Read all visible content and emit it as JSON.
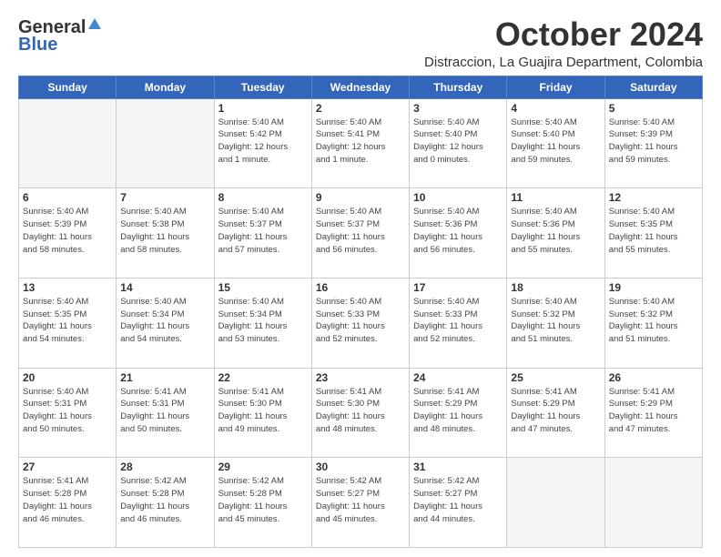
{
  "logo": {
    "general": "General",
    "blue": "Blue"
  },
  "header": {
    "month": "October 2024",
    "location": "Distraccion, La Guajira Department, Colombia"
  },
  "weekdays": [
    "Sunday",
    "Monday",
    "Tuesday",
    "Wednesday",
    "Thursday",
    "Friday",
    "Saturday"
  ],
  "weeks": [
    [
      {
        "day": "",
        "info": ""
      },
      {
        "day": "",
        "info": ""
      },
      {
        "day": "1",
        "info": "Sunrise: 5:40 AM\nSunset: 5:42 PM\nDaylight: 12 hours\nand 1 minute."
      },
      {
        "day": "2",
        "info": "Sunrise: 5:40 AM\nSunset: 5:41 PM\nDaylight: 12 hours\nand 1 minute."
      },
      {
        "day": "3",
        "info": "Sunrise: 5:40 AM\nSunset: 5:40 PM\nDaylight: 12 hours\nand 0 minutes."
      },
      {
        "day": "4",
        "info": "Sunrise: 5:40 AM\nSunset: 5:40 PM\nDaylight: 11 hours\nand 59 minutes."
      },
      {
        "day": "5",
        "info": "Sunrise: 5:40 AM\nSunset: 5:39 PM\nDaylight: 11 hours\nand 59 minutes."
      }
    ],
    [
      {
        "day": "6",
        "info": "Sunrise: 5:40 AM\nSunset: 5:39 PM\nDaylight: 11 hours\nand 58 minutes."
      },
      {
        "day": "7",
        "info": "Sunrise: 5:40 AM\nSunset: 5:38 PM\nDaylight: 11 hours\nand 58 minutes."
      },
      {
        "day": "8",
        "info": "Sunrise: 5:40 AM\nSunset: 5:37 PM\nDaylight: 11 hours\nand 57 minutes."
      },
      {
        "day": "9",
        "info": "Sunrise: 5:40 AM\nSunset: 5:37 PM\nDaylight: 11 hours\nand 56 minutes."
      },
      {
        "day": "10",
        "info": "Sunrise: 5:40 AM\nSunset: 5:36 PM\nDaylight: 11 hours\nand 56 minutes."
      },
      {
        "day": "11",
        "info": "Sunrise: 5:40 AM\nSunset: 5:36 PM\nDaylight: 11 hours\nand 55 minutes."
      },
      {
        "day": "12",
        "info": "Sunrise: 5:40 AM\nSunset: 5:35 PM\nDaylight: 11 hours\nand 55 minutes."
      }
    ],
    [
      {
        "day": "13",
        "info": "Sunrise: 5:40 AM\nSunset: 5:35 PM\nDaylight: 11 hours\nand 54 minutes."
      },
      {
        "day": "14",
        "info": "Sunrise: 5:40 AM\nSunset: 5:34 PM\nDaylight: 11 hours\nand 54 minutes."
      },
      {
        "day": "15",
        "info": "Sunrise: 5:40 AM\nSunset: 5:34 PM\nDaylight: 11 hours\nand 53 minutes."
      },
      {
        "day": "16",
        "info": "Sunrise: 5:40 AM\nSunset: 5:33 PM\nDaylight: 11 hours\nand 52 minutes."
      },
      {
        "day": "17",
        "info": "Sunrise: 5:40 AM\nSunset: 5:33 PM\nDaylight: 11 hours\nand 52 minutes."
      },
      {
        "day": "18",
        "info": "Sunrise: 5:40 AM\nSunset: 5:32 PM\nDaylight: 11 hours\nand 51 minutes."
      },
      {
        "day": "19",
        "info": "Sunrise: 5:40 AM\nSunset: 5:32 PM\nDaylight: 11 hours\nand 51 minutes."
      }
    ],
    [
      {
        "day": "20",
        "info": "Sunrise: 5:40 AM\nSunset: 5:31 PM\nDaylight: 11 hours\nand 50 minutes."
      },
      {
        "day": "21",
        "info": "Sunrise: 5:41 AM\nSunset: 5:31 PM\nDaylight: 11 hours\nand 50 minutes."
      },
      {
        "day": "22",
        "info": "Sunrise: 5:41 AM\nSunset: 5:30 PM\nDaylight: 11 hours\nand 49 minutes."
      },
      {
        "day": "23",
        "info": "Sunrise: 5:41 AM\nSunset: 5:30 PM\nDaylight: 11 hours\nand 48 minutes."
      },
      {
        "day": "24",
        "info": "Sunrise: 5:41 AM\nSunset: 5:29 PM\nDaylight: 11 hours\nand 48 minutes."
      },
      {
        "day": "25",
        "info": "Sunrise: 5:41 AM\nSunset: 5:29 PM\nDaylight: 11 hours\nand 47 minutes."
      },
      {
        "day": "26",
        "info": "Sunrise: 5:41 AM\nSunset: 5:29 PM\nDaylight: 11 hours\nand 47 minutes."
      }
    ],
    [
      {
        "day": "27",
        "info": "Sunrise: 5:41 AM\nSunset: 5:28 PM\nDaylight: 11 hours\nand 46 minutes."
      },
      {
        "day": "28",
        "info": "Sunrise: 5:42 AM\nSunset: 5:28 PM\nDaylight: 11 hours\nand 46 minutes."
      },
      {
        "day": "29",
        "info": "Sunrise: 5:42 AM\nSunset: 5:28 PM\nDaylight: 11 hours\nand 45 minutes."
      },
      {
        "day": "30",
        "info": "Sunrise: 5:42 AM\nSunset: 5:27 PM\nDaylight: 11 hours\nand 45 minutes."
      },
      {
        "day": "31",
        "info": "Sunrise: 5:42 AM\nSunset: 5:27 PM\nDaylight: 11 hours\nand 44 minutes."
      },
      {
        "day": "",
        "info": ""
      },
      {
        "day": "",
        "info": ""
      }
    ]
  ]
}
